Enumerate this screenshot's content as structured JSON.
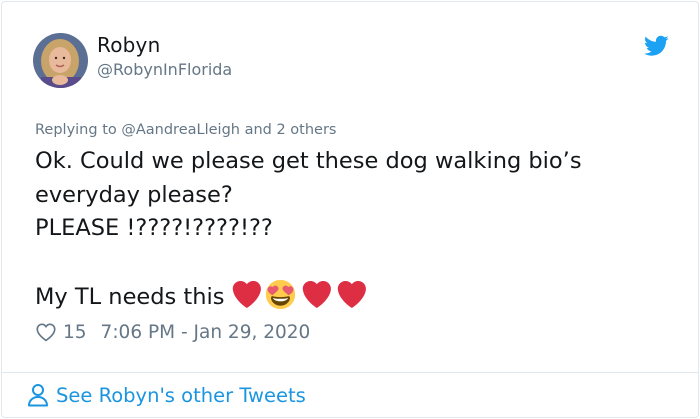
{
  "author": {
    "name": "Robyn",
    "handle": "@RobynInFlorida"
  },
  "reply_context": {
    "prefix": "Replying to ",
    "mention": "@AandreaLleigh",
    "suffix": " and 2 others"
  },
  "tweet": {
    "lines": [
      "Ok. Could we please get these dog walking bio’s",
      "everyday please?",
      "PLEASE !????!????!??",
      "",
      "My TL needs this"
    ],
    "emojis": [
      "red-heart-icon",
      "heart-eyes-face-icon",
      "red-heart-icon",
      "red-heart-icon"
    ]
  },
  "meta": {
    "likes": "15",
    "timestamp": "7:06 PM - Jan 29, 2020"
  },
  "footer": {
    "see_more_label": "See Robyn's other Tweets"
  },
  "colors": {
    "link": "#1b95e0",
    "secondary_text": "#657786",
    "border": "#e1e8ed",
    "heart_red": "#dd2e44",
    "emoji_yellow": "#ffcc4d"
  }
}
